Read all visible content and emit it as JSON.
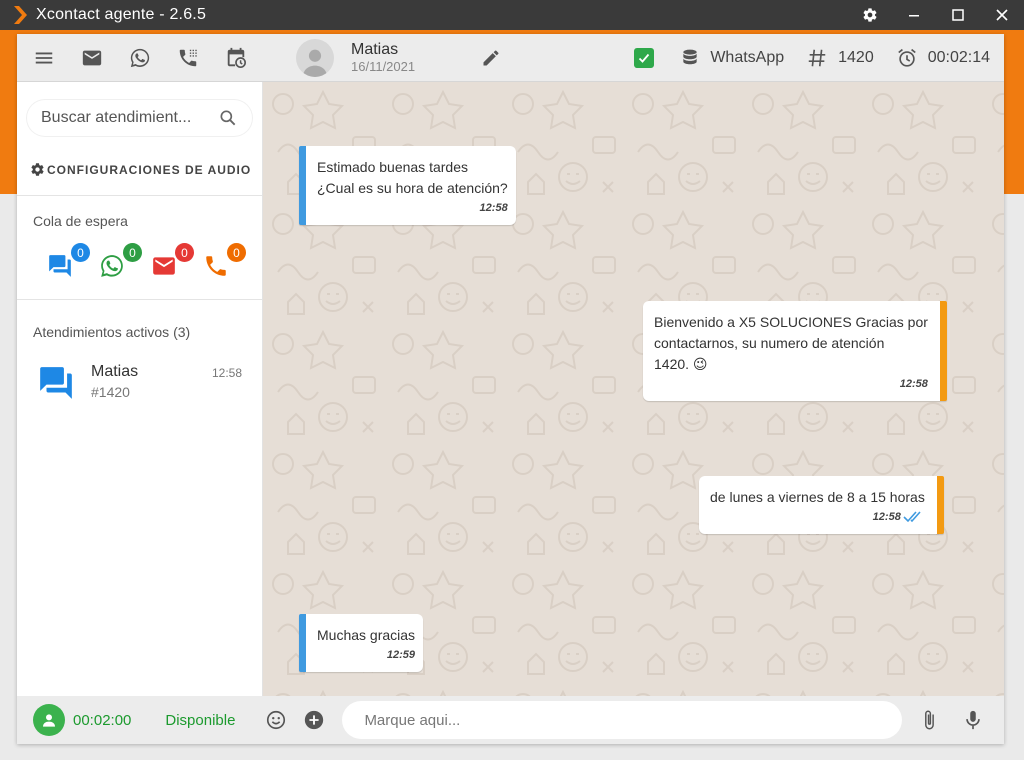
{
  "window": {
    "title": "Xcontact agente - 2.6.5",
    "controls": [
      "gear-icon",
      "minimize-icon",
      "maximize-icon",
      "close-icon"
    ]
  },
  "colors": {
    "accent_orange": "#f07b10",
    "incoming_border": "#3f9ae0",
    "outgoing_border": "#f39a12",
    "status_green": "#1c9a2e",
    "chat_bg": "#e6ded6"
  },
  "toolbar": {
    "left_icons": [
      "menu-icon",
      "mail-icon",
      "whatsapp-icon",
      "dialpad-phone-icon",
      "calendar-clock-icon"
    ],
    "contact_name": "Matias",
    "contact_date": "16/11/2021",
    "channel": "WhatsApp",
    "ticket_number": "1420",
    "elapsed_time": "00:02:14"
  },
  "sidebar": {
    "search_placeholder": "Buscar atendimient...",
    "audio_config_label": "CONFIGURACIONES DE AUDIO",
    "queue_label": "Cola de espera",
    "queue_items": [
      {
        "icon": "chat-icon",
        "count": "0",
        "color": "#1e88e5",
        "badge_color": "#1e88e5"
      },
      {
        "icon": "whatsapp-icon",
        "count": "0",
        "color": "#2e9e44",
        "badge_color": "#2e9e44"
      },
      {
        "icon": "mail-icon",
        "count": "0",
        "color": "#e53935",
        "badge_color": "#e53935"
      },
      {
        "icon": "phone-icon",
        "count": "0",
        "color": "#ef6c00",
        "badge_color": "#ef6c00"
      }
    ],
    "active_label": "Atendimientos activos (3)",
    "active_items": [
      {
        "name": "Matias",
        "number": "#1420",
        "time": "12:58"
      }
    ]
  },
  "messages": [
    {
      "direction": "in",
      "lines": [
        "Estimado buenas tardes",
        "¿Cual es su hora de atención?"
      ],
      "time": "12:58"
    },
    {
      "direction": "out",
      "lines": [
        "Bienvenido a X5 SOLUCIONES Gracias por",
        "contactarnos, su numero de atención",
        "1420. 😉"
      ],
      "time": "12:58"
    },
    {
      "direction": "out",
      "lines": [
        "de lunes a viernes de 8 a 15 horas"
      ],
      "time": "12:58",
      "read_receipt": true
    },
    {
      "direction": "in",
      "lines": [
        "Muchas gracias"
      ],
      "time": "12:59"
    }
  ],
  "bottombar": {
    "agent_time": "00:02:00",
    "agent_status": "Disponible",
    "input_placeholder": "Marque aqui..."
  }
}
